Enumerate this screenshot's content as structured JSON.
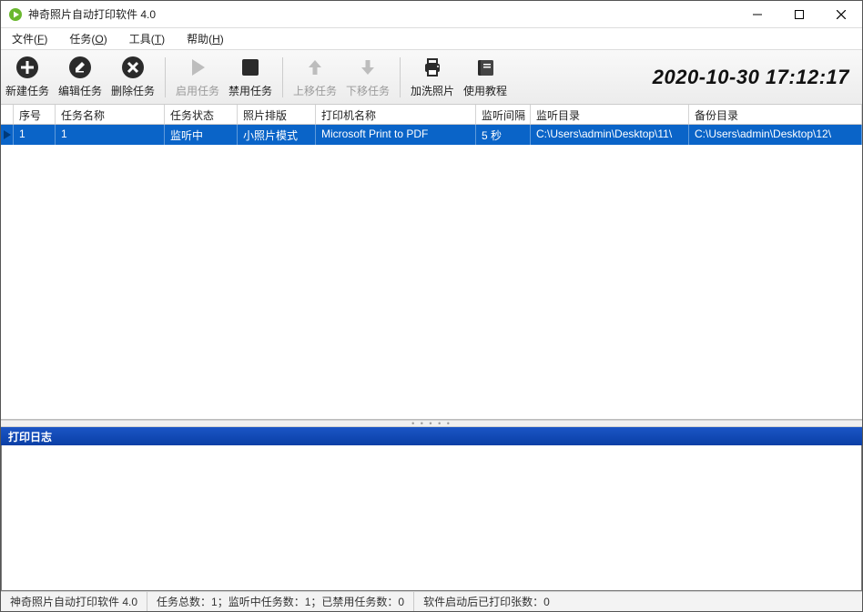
{
  "window": {
    "title": "神奇照片自动打印软件 4.0"
  },
  "menu": {
    "file": {
      "label": "文件",
      "mn": "F"
    },
    "task": {
      "label": "任务",
      "mn": "O"
    },
    "tool": {
      "label": "工具",
      "mn": "T"
    },
    "help": {
      "label": "帮助",
      "mn": "H"
    }
  },
  "toolbar": {
    "new": "新建任务",
    "edit": "编辑任务",
    "delete": "删除任务",
    "enable": "启用任务",
    "disable": "禁用任务",
    "moveup": "上移任务",
    "movedown": "下移任务",
    "addphoto": "加洗照片",
    "tutorial": "使用教程",
    "clock": "2020-10-30 17:12:17"
  },
  "columns": {
    "c0": "序号",
    "c1": "任务名称",
    "c2": "任务状态",
    "c3": "照片排版",
    "c4": "打印机名称",
    "c5": "监听间隔",
    "c6": "监听目录",
    "c7": "备份目录"
  },
  "rows": [
    {
      "seq": "1",
      "name": "1",
      "status": "监听中",
      "layout": "小照片模式",
      "printer": "Microsoft Print to PDF",
      "interval": "5 秒",
      "watchdir": "C:\\Users\\admin\\Desktop\\11\\",
      "backupdir": "C:\\Users\\admin\\Desktop\\12\\"
    }
  ],
  "log": {
    "title": "打印日志"
  },
  "status": {
    "app": "神奇照片自动打印软件 4.0",
    "counts": "任务总数：1；监听中任务数：1；已禁用任务数：0",
    "printed": "软件启动后已打印张数：0"
  }
}
